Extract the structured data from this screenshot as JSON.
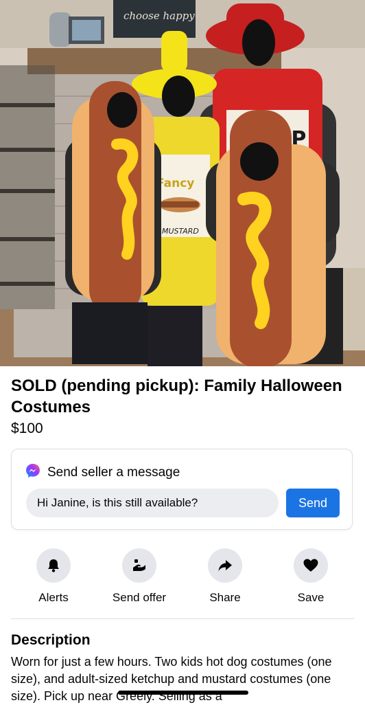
{
  "photo": {
    "sign_text": "choose happy",
    "mustard_label_top": "Fancy",
    "mustard_label_bottom": "MUSTARD",
    "ketchup_label": "UP"
  },
  "listing": {
    "title": "SOLD (pending pickup): Family Halloween Costumes",
    "price": "$100"
  },
  "message": {
    "heading": "Send seller a message",
    "input_value": "Hi Janine, is this still available?",
    "send_label": "Send",
    "messenger_colors": [
      "#0695ff",
      "#a334fa",
      "#ff6968"
    ]
  },
  "actions": [
    {
      "label": "Alerts",
      "icon": "bell-icon"
    },
    {
      "label": "Send offer",
      "icon": "offer-icon"
    },
    {
      "label": "Share",
      "icon": "share-arrow-icon"
    },
    {
      "label": "Save",
      "icon": "heart-icon"
    }
  ],
  "description": {
    "heading": "Description",
    "text": "Worn for just a few hours. Two kids hot dog costumes (one size), and adult-sized ketchup and mustard costumes (one size). Pick up near Greely. Selling as a"
  }
}
